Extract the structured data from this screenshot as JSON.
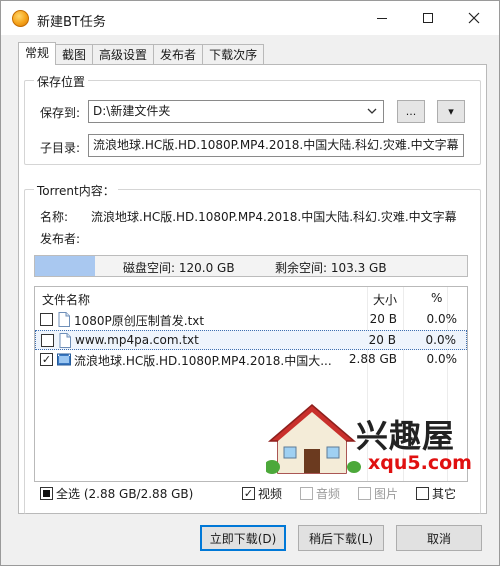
{
  "window": {
    "title": "新建BT任务"
  },
  "tabs": [
    {
      "label": "常规",
      "active": true
    },
    {
      "label": "截图"
    },
    {
      "label": "高级设置"
    },
    {
      "label": "发布者"
    },
    {
      "label": "下载次序"
    }
  ],
  "save": {
    "group_label": "保存位置",
    "save_to_label": "保存到:",
    "save_to_value": "D:\\新建文件夹",
    "browse_label": "...",
    "menu_label": "▾",
    "subdir_label": "子目录:",
    "subdir_value": "流浪地球.HC版.HD.1080P.MP4.2018.中国大陆.科幻.灾难.中文字幕"
  },
  "torrent": {
    "group_label": "Torrent内容：",
    "name_label": "名称:",
    "name_value": "流浪地球.HC版.HD.1080P.MP4.2018.中国大陆.科幻.灾难.中文字幕",
    "publisher_label": "发布者:",
    "disk_space_text": "磁盘空间: 120.0 GB",
    "free_space_text": "剩余空间: 103.3 GB",
    "disk_used_fraction": 0.14
  },
  "file_list": {
    "headers": {
      "name": "文件名称",
      "size": "大小",
      "pct": "%"
    },
    "rows": [
      {
        "name": "1080P原创压制首发.txt",
        "size": "20 B",
        "pct": "0.0%",
        "checked": false,
        "icon": "text-file-icon"
      },
      {
        "name": "www.mp4pa.com.txt",
        "size": "20 B",
        "pct": "0.0%",
        "checked": false,
        "icon": "text-file-icon",
        "selected": true
      },
      {
        "name": "流浪地球.HC版.HD.1080P.MP4.2018.中国大...",
        "size": "2.88 GB",
        "pct": "0.0%",
        "checked": true,
        "icon": "video-file-icon"
      }
    ]
  },
  "watermark": {
    "cn": "兴趣屋",
    "domain": "xqu5.com"
  },
  "filters": {
    "all": "全选 (2.88 GB/2.88 GB)",
    "video": "视频",
    "audio": "音频",
    "image": "图片",
    "other": "其它"
  },
  "buttons": {
    "download_now": "立即下载(D)",
    "download_later": "稍后下载(L)",
    "cancel": "取消"
  },
  "colors": {
    "accent": "#0078d7",
    "disk_fill": "#a9c8f0",
    "watermark_red": "#e01010"
  }
}
